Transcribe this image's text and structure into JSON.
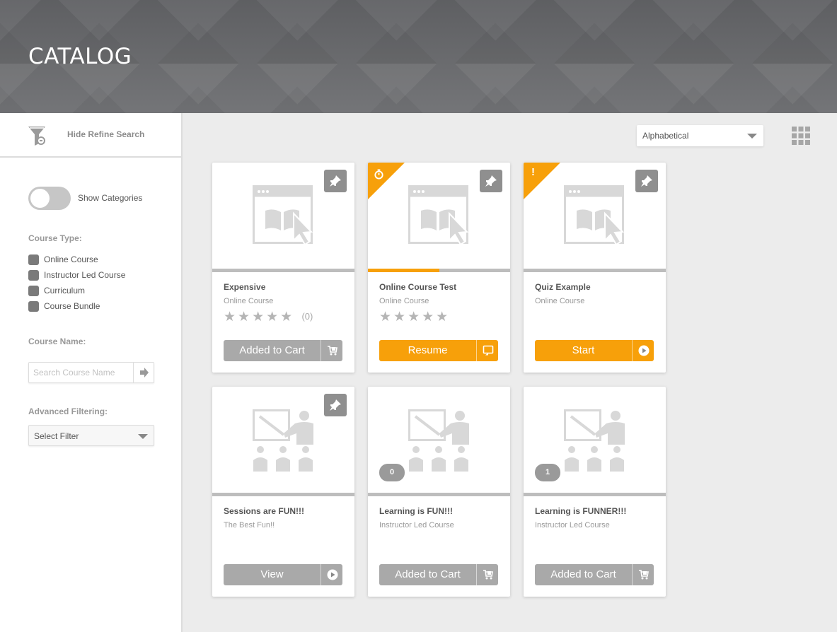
{
  "header": {
    "title": "CATALOG"
  },
  "sidebar": {
    "refine_label": "Hide Refine Search",
    "toggle_label": "Show Categories",
    "toggle_on": false,
    "course_type_label": "Course Type:",
    "course_types": [
      "Online Course",
      "Instructor Led Course",
      "Curriculum",
      "Course Bundle"
    ],
    "course_name_label": "Course Name:",
    "search_placeholder": "Search Course Name",
    "advanced_label": "Advanced Filtering:",
    "filter_value": "Select Filter"
  },
  "toolbar": {
    "sort_value": "Alphabetical",
    "view_icon": "grid-view-icon"
  },
  "colors": {
    "accent": "#f7a00a",
    "button_gray": "#a9a9a9"
  },
  "cards": [
    {
      "title": "Expensive",
      "subtitle": "Online Course",
      "stars": "★★★★★",
      "rating": "(0)",
      "button": "Added to Cart",
      "button_icon": "cart-icon"
    },
    {
      "title": "Online Course Test",
      "subtitle": "Online Course",
      "stars": "★★★★★",
      "progress": 0.5,
      "corner_icon": "timer-icon",
      "button": "Resume",
      "button_icon": "resume-icon"
    },
    {
      "title": "Quiz Example",
      "subtitle": "Online Course",
      "corner_glyph": "!",
      "button": "Start",
      "button_icon": "play-icon"
    },
    {
      "title": "Sessions are FUN!!!",
      "subtitle": "The Best Fun!!",
      "button": "View",
      "button_icon": "play-icon"
    },
    {
      "title": "Learning is FUN!!!",
      "subtitle": "Instructor Led Course",
      "count": "0",
      "button": "Added to Cart",
      "button_icon": "cart-icon"
    },
    {
      "title": "Learning is FUNNER!!!",
      "subtitle": "Instructor Led Course",
      "count": "1",
      "button": "Added to Cart",
      "button_icon": "cart-icon"
    }
  ]
}
